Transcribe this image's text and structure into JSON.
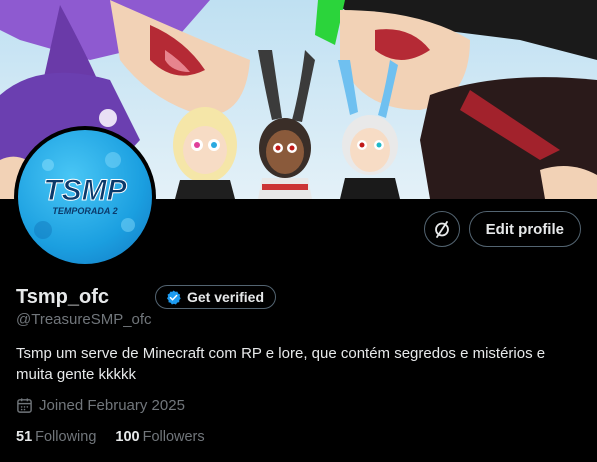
{
  "profile": {
    "display_name": "Tsmp_ofc",
    "handle": "@TreasureSMP_ofc",
    "bio": "Tsmp um serve de Minecraft com RP e lore, que contém segredos e mistérios e muita gente kkkkk",
    "joined": "Joined February 2025",
    "avatar_text": {
      "line1": "TSMP",
      "line2": "TEMPORADA 2"
    }
  },
  "actions": {
    "unlink_icon": "circle-slash-icon",
    "edit_profile_label": "Edit profile",
    "get_verified_label": "Get verified"
  },
  "stats": {
    "following_count": "51",
    "following_label": "Following",
    "followers_count": "100",
    "followers_label": "Followers"
  },
  "colors": {
    "background": "#000000",
    "primary_text": "#e7e9ea",
    "secondary_text": "#71767b",
    "border": "#536471",
    "verified_blue": "#1d9bf0"
  }
}
